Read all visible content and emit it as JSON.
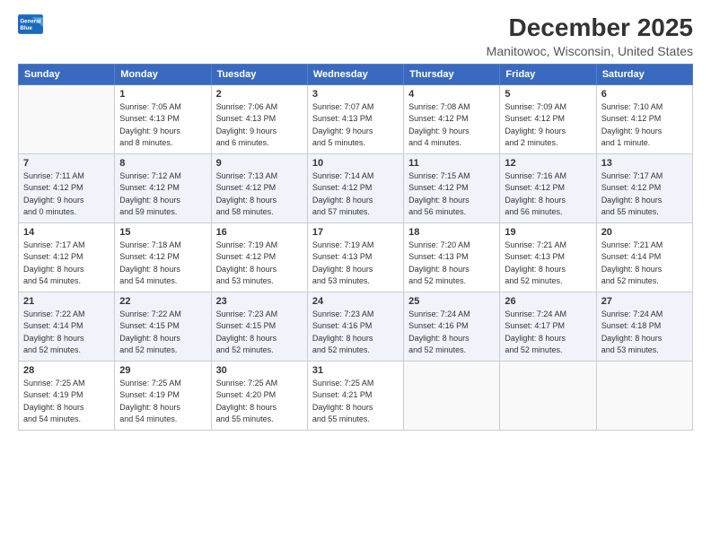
{
  "logo": {
    "line1": "General",
    "line2": "Blue"
  },
  "title": "December 2025",
  "subtitle": "Manitowoc, Wisconsin, United States",
  "days_header": [
    "Sunday",
    "Monday",
    "Tuesday",
    "Wednesday",
    "Thursday",
    "Friday",
    "Saturday"
  ],
  "weeks": [
    [
      {
        "day": "",
        "info": []
      },
      {
        "day": "1",
        "info": [
          "Sunrise: 7:05 AM",
          "Sunset: 4:13 PM",
          "Daylight: 9 hours",
          "and 8 minutes."
        ]
      },
      {
        "day": "2",
        "info": [
          "Sunrise: 7:06 AM",
          "Sunset: 4:13 PM",
          "Daylight: 9 hours",
          "and 6 minutes."
        ]
      },
      {
        "day": "3",
        "info": [
          "Sunrise: 7:07 AM",
          "Sunset: 4:13 PM",
          "Daylight: 9 hours",
          "and 5 minutes."
        ]
      },
      {
        "day": "4",
        "info": [
          "Sunrise: 7:08 AM",
          "Sunset: 4:12 PM",
          "Daylight: 9 hours",
          "and 4 minutes."
        ]
      },
      {
        "day": "5",
        "info": [
          "Sunrise: 7:09 AM",
          "Sunset: 4:12 PM",
          "Daylight: 9 hours",
          "and 2 minutes."
        ]
      },
      {
        "day": "6",
        "info": [
          "Sunrise: 7:10 AM",
          "Sunset: 4:12 PM",
          "Daylight: 9 hours",
          "and 1 minute."
        ]
      }
    ],
    [
      {
        "day": "7",
        "info": [
          "Sunrise: 7:11 AM",
          "Sunset: 4:12 PM",
          "Daylight: 9 hours",
          "and 0 minutes."
        ]
      },
      {
        "day": "8",
        "info": [
          "Sunrise: 7:12 AM",
          "Sunset: 4:12 PM",
          "Daylight: 8 hours",
          "and 59 minutes."
        ]
      },
      {
        "day": "9",
        "info": [
          "Sunrise: 7:13 AM",
          "Sunset: 4:12 PM",
          "Daylight: 8 hours",
          "and 58 minutes."
        ]
      },
      {
        "day": "10",
        "info": [
          "Sunrise: 7:14 AM",
          "Sunset: 4:12 PM",
          "Daylight: 8 hours",
          "and 57 minutes."
        ]
      },
      {
        "day": "11",
        "info": [
          "Sunrise: 7:15 AM",
          "Sunset: 4:12 PM",
          "Daylight: 8 hours",
          "and 56 minutes."
        ]
      },
      {
        "day": "12",
        "info": [
          "Sunrise: 7:16 AM",
          "Sunset: 4:12 PM",
          "Daylight: 8 hours",
          "and 56 minutes."
        ]
      },
      {
        "day": "13",
        "info": [
          "Sunrise: 7:17 AM",
          "Sunset: 4:12 PM",
          "Daylight: 8 hours",
          "and 55 minutes."
        ]
      }
    ],
    [
      {
        "day": "14",
        "info": [
          "Sunrise: 7:17 AM",
          "Sunset: 4:12 PM",
          "Daylight: 8 hours",
          "and 54 minutes."
        ]
      },
      {
        "day": "15",
        "info": [
          "Sunrise: 7:18 AM",
          "Sunset: 4:12 PM",
          "Daylight: 8 hours",
          "and 54 minutes."
        ]
      },
      {
        "day": "16",
        "info": [
          "Sunrise: 7:19 AM",
          "Sunset: 4:12 PM",
          "Daylight: 8 hours",
          "and 53 minutes."
        ]
      },
      {
        "day": "17",
        "info": [
          "Sunrise: 7:19 AM",
          "Sunset: 4:13 PM",
          "Daylight: 8 hours",
          "and 53 minutes."
        ]
      },
      {
        "day": "18",
        "info": [
          "Sunrise: 7:20 AM",
          "Sunset: 4:13 PM",
          "Daylight: 8 hours",
          "and 52 minutes."
        ]
      },
      {
        "day": "19",
        "info": [
          "Sunrise: 7:21 AM",
          "Sunset: 4:13 PM",
          "Daylight: 8 hours",
          "and 52 minutes."
        ]
      },
      {
        "day": "20",
        "info": [
          "Sunrise: 7:21 AM",
          "Sunset: 4:14 PM",
          "Daylight: 8 hours",
          "and 52 minutes."
        ]
      }
    ],
    [
      {
        "day": "21",
        "info": [
          "Sunrise: 7:22 AM",
          "Sunset: 4:14 PM",
          "Daylight: 8 hours",
          "and 52 minutes."
        ]
      },
      {
        "day": "22",
        "info": [
          "Sunrise: 7:22 AM",
          "Sunset: 4:15 PM",
          "Daylight: 8 hours",
          "and 52 minutes."
        ]
      },
      {
        "day": "23",
        "info": [
          "Sunrise: 7:23 AM",
          "Sunset: 4:15 PM",
          "Daylight: 8 hours",
          "and 52 minutes."
        ]
      },
      {
        "day": "24",
        "info": [
          "Sunrise: 7:23 AM",
          "Sunset: 4:16 PM",
          "Daylight: 8 hours",
          "and 52 minutes."
        ]
      },
      {
        "day": "25",
        "info": [
          "Sunrise: 7:24 AM",
          "Sunset: 4:16 PM",
          "Daylight: 8 hours",
          "and 52 minutes."
        ]
      },
      {
        "day": "26",
        "info": [
          "Sunrise: 7:24 AM",
          "Sunset: 4:17 PM",
          "Daylight: 8 hours",
          "and 52 minutes."
        ]
      },
      {
        "day": "27",
        "info": [
          "Sunrise: 7:24 AM",
          "Sunset: 4:18 PM",
          "Daylight: 8 hours",
          "and 53 minutes."
        ]
      }
    ],
    [
      {
        "day": "28",
        "info": [
          "Sunrise: 7:25 AM",
          "Sunset: 4:19 PM",
          "Daylight: 8 hours",
          "and 54 minutes."
        ]
      },
      {
        "day": "29",
        "info": [
          "Sunrise: 7:25 AM",
          "Sunset: 4:19 PM",
          "Daylight: 8 hours",
          "and 54 minutes."
        ]
      },
      {
        "day": "30",
        "info": [
          "Sunrise: 7:25 AM",
          "Sunset: 4:20 PM",
          "Daylight: 8 hours",
          "and 55 minutes."
        ]
      },
      {
        "day": "31",
        "info": [
          "Sunrise: 7:25 AM",
          "Sunset: 4:21 PM",
          "Daylight: 8 hours",
          "and 55 minutes."
        ]
      },
      {
        "day": "",
        "info": []
      },
      {
        "day": "",
        "info": []
      },
      {
        "day": "",
        "info": []
      }
    ]
  ]
}
